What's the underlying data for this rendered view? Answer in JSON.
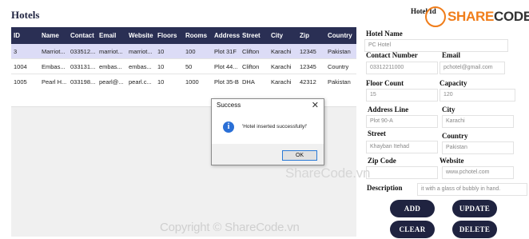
{
  "page_title": "Hotels",
  "grid": {
    "columns": [
      "ID",
      "Name",
      "Contact",
      "Email",
      "Website",
      "Floors",
      "Rooms",
      "Address",
      "Street",
      "City",
      "Zip",
      "Country"
    ],
    "rows": [
      [
        "3",
        "Marriot...",
        "033512...",
        "marriot...",
        "marriot...",
        "10",
        "100",
        "Plot 31F",
        "Clifton",
        "Karachi",
        "12345",
        "Pakistan"
      ],
      [
        "1004",
        "Embas...",
        "033131...",
        "embas...",
        "embas...",
        "10",
        "50",
        "Plot 44...",
        "Clifton",
        "Karachi",
        "12345",
        "Country"
      ],
      [
        "1005",
        "Pearl H...",
        "033198...",
        "pearl@...",
        "pearl.c...",
        "10",
        "1000",
        "Plot 35-B",
        "DHA",
        "Karachi",
        "42312",
        "Pakistan"
      ]
    ]
  },
  "form": {
    "hotel_id_label": "Hotel Id",
    "hotel_name_label": "Hotel Name",
    "hotel_name_value": "PC Hotel",
    "contact_label": "Contact Number",
    "contact_value": "03312211000",
    "email_label": "Email",
    "email_value": "pchotel@gmail.com",
    "floor_label": "Floor Count",
    "floor_value": "15",
    "capacity_label": "Capacity",
    "capacity_value": "120",
    "address_label": "Address Line",
    "address_value": "Plot 90-A",
    "city_label": "City",
    "city_value": "Karachi",
    "street_label": "Street",
    "street_value": "Khayban Itehad",
    "country_label": "Country",
    "country_value": "Pakistan",
    "zip_label": "Zip Code",
    "zip_value": "",
    "website_label": "Website",
    "website_value": "www.pchotel.com",
    "description_label": "Description",
    "description_value": "it with a glass of bubbly in hand."
  },
  "buttons": {
    "add": "ADD",
    "update": "UPDATE",
    "clear": "CLEAR",
    "delete": "DELETE"
  },
  "dialog": {
    "title": "Success",
    "close": "✕",
    "icon": "i",
    "message": "'Hotel inserted successfully!'",
    "ok": "OK"
  },
  "watermark": {
    "logo_share": "SHARE",
    "logo_code": "CODE.vn",
    "center": "ShareCode.vn",
    "bottom": "Copyright © ShareCode.vn"
  },
  "colors": {
    "header_bg": "#2a2f54",
    "button_bg": "#1f2340",
    "selected_row": "#dcdcf6",
    "brand_orange": "#f07d1a"
  }
}
